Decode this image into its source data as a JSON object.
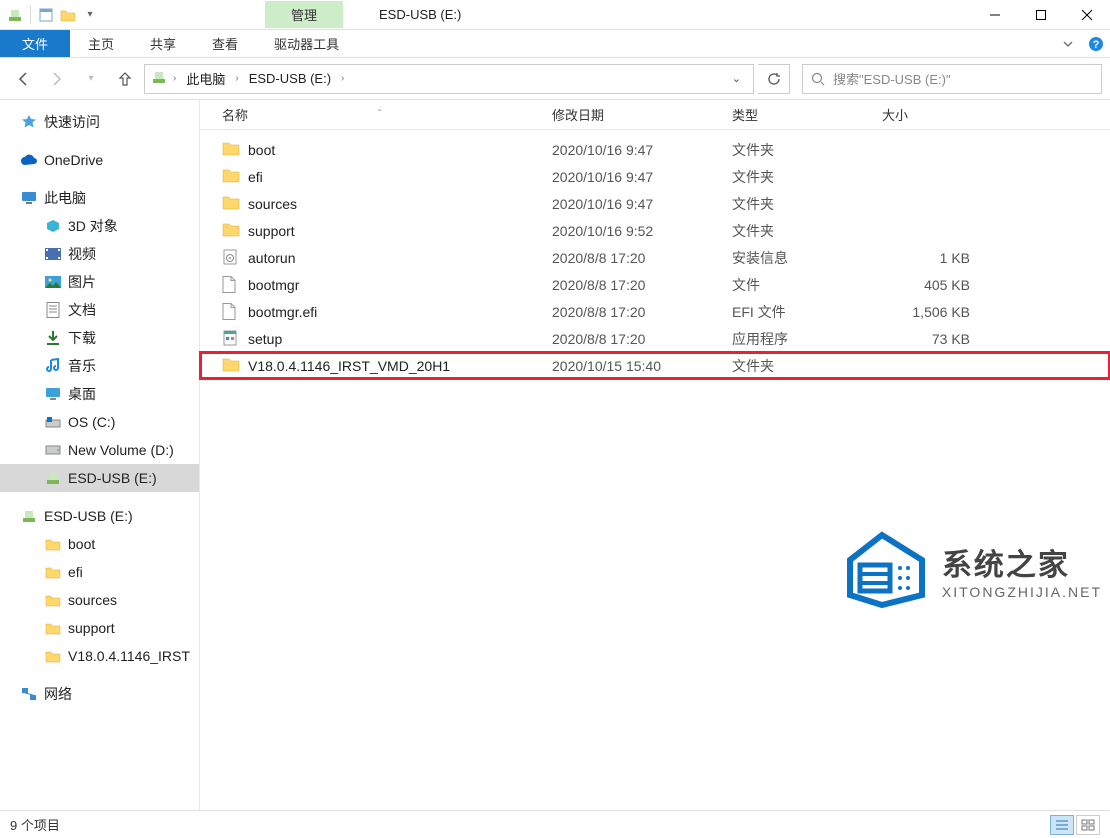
{
  "window": {
    "title": "ESD-USB (E:)",
    "contextTab": "管理",
    "contextGroup": "驱动器工具"
  },
  "ribbon": {
    "file": "文件",
    "tabs": [
      "主页",
      "共享",
      "查看"
    ]
  },
  "breadcrumb": [
    "此电脑",
    "ESD-USB (E:)"
  ],
  "search": {
    "placeholder": "搜索\"ESD-USB (E:)\""
  },
  "sidebar": {
    "quick": "快速访问",
    "onedrive": "OneDrive",
    "pc": "此电脑",
    "pc_children": [
      "3D 对象",
      "视频",
      "图片",
      "文档",
      "下载",
      "音乐",
      "桌面",
      "OS (C:)",
      "New Volume (D:)",
      "ESD-USB (E:)"
    ],
    "usb": "ESD-USB (E:)",
    "usb_children": [
      "boot",
      "efi",
      "sources",
      "support",
      "V18.0.4.1146_IRST"
    ],
    "network": "网络"
  },
  "columns": {
    "name": "名称",
    "date": "修改日期",
    "type": "类型",
    "size": "大小"
  },
  "files": [
    {
      "icon": "folder",
      "name": "boot",
      "date": "2020/10/16 9:47",
      "type": "文件夹",
      "size": ""
    },
    {
      "icon": "folder",
      "name": "efi",
      "date": "2020/10/16 9:47",
      "type": "文件夹",
      "size": ""
    },
    {
      "icon": "folder",
      "name": "sources",
      "date": "2020/10/16 9:47",
      "type": "文件夹",
      "size": ""
    },
    {
      "icon": "folder",
      "name": "support",
      "date": "2020/10/16 9:52",
      "type": "文件夹",
      "size": ""
    },
    {
      "icon": "inf",
      "name": "autorun",
      "date": "2020/8/8 17:20",
      "type": "安装信息",
      "size": "1 KB"
    },
    {
      "icon": "file",
      "name": "bootmgr",
      "date": "2020/8/8 17:20",
      "type": "文件",
      "size": "405 KB"
    },
    {
      "icon": "file",
      "name": "bootmgr.efi",
      "date": "2020/8/8 17:20",
      "type": "EFI 文件",
      "size": "1,506 KB"
    },
    {
      "icon": "exe",
      "name": "setup",
      "date": "2020/8/8 17:20",
      "type": "应用程序",
      "size": "73 KB"
    },
    {
      "icon": "folder",
      "name": "V18.0.4.1146_IRST_VMD_20H1",
      "date": "2020/10/15 15:40",
      "type": "文件夹",
      "size": "",
      "hl": true
    }
  ],
  "status": {
    "count": "9 个项目"
  },
  "watermark": {
    "big": "系统之家",
    "small": "XITONGZHIJIA.NET"
  }
}
